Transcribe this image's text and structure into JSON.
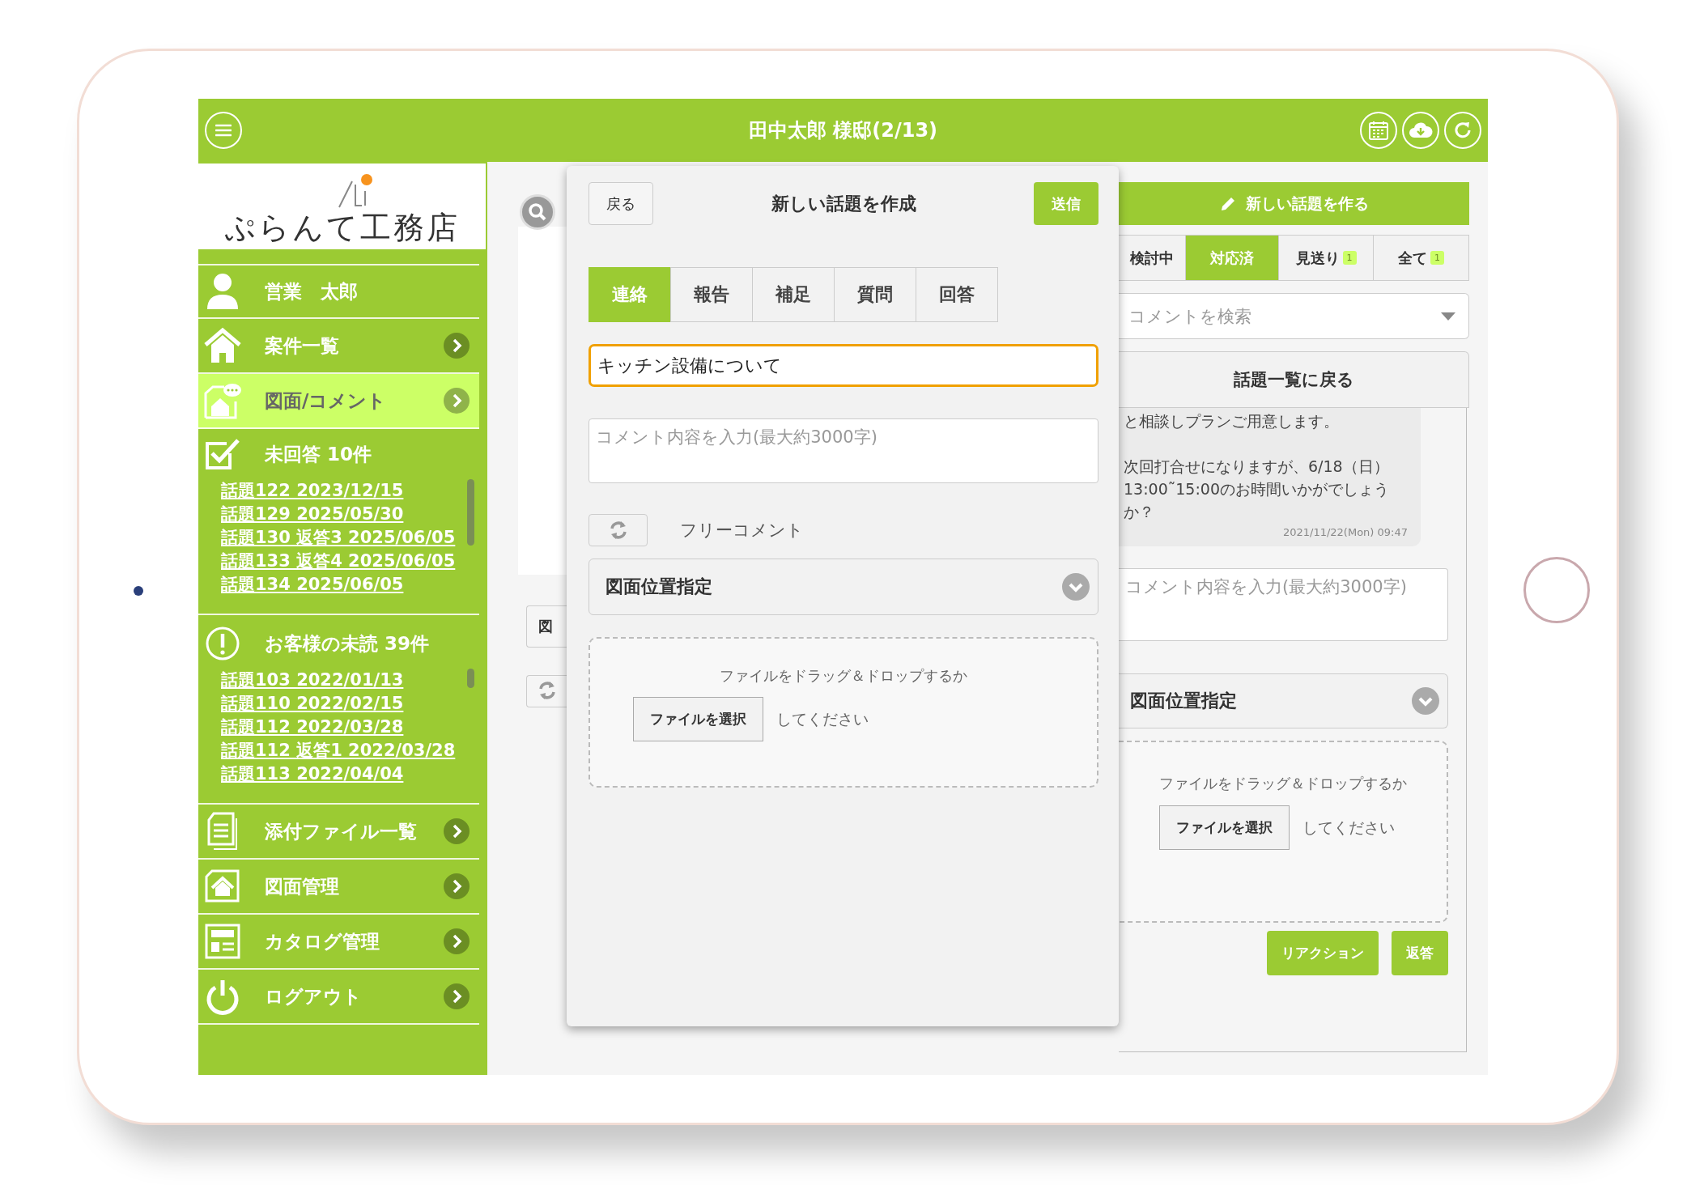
{
  "header": {
    "title": "田中太郎 様邸(2/13)"
  },
  "sidebar": {
    "logo": "ぷらんて工務店",
    "user": "営業　太郎",
    "nav": [
      {
        "label": "案件一覧",
        "selected": false
      },
      {
        "label": "図面/コメント",
        "selected": true
      }
    ],
    "sections": [
      {
        "title": "未回答 10件",
        "links": [
          "話題122 2023/12/15",
          "話題129 2025/05/30",
          "話題130 返答3 2025/06/05",
          "話題133 返答4 2025/06/05",
          "話題134 2025/06/05"
        ]
      },
      {
        "title": "お客様の未読 39件",
        "links": [
          "話題103 2022/01/13",
          "話題110 2022/02/15",
          "話題112 2022/03/28",
          "話題112 返答1 2022/03/28",
          "話題113 2022/04/04"
        ]
      }
    ],
    "nav_bottom": [
      {
        "label": "添付ファイル一覧",
        "selected": false
      },
      {
        "label": "図面管理",
        "selected": false
      },
      {
        "label": "カタログ管理",
        "selected": false
      },
      {
        "label": "ログアウト",
        "selected": false
      }
    ]
  },
  "background": {
    "button": "図"
  },
  "modal": {
    "back": "戻る",
    "title": "新しい話題を作成",
    "send": "送信",
    "tabs": [
      {
        "label": "連絡",
        "selected": true
      },
      {
        "label": "報告",
        "selected": false
      },
      {
        "label": "補足",
        "selected": false
      },
      {
        "label": "質問",
        "selected": false
      },
      {
        "label": "回答",
        "selected": false
      }
    ],
    "subject": {
      "value": "キッチン設備について"
    },
    "comment": {
      "placeholder": "コメント内容を入力(最大約3000字)"
    },
    "free_comment": "フリーコメント",
    "position_select": "図面位置指定",
    "dropzone": {
      "text": "ファイルをドラッグ＆ドロップするか",
      "button": "ファイルを選択",
      "suffix": "してください"
    }
  },
  "panel": {
    "new_topic": "新しい話題を作る",
    "tabs": [
      {
        "label": "検討中",
        "selected": false
      },
      {
        "label": "対応済",
        "selected": true
      },
      {
        "label": "見送り",
        "badge": "1",
        "selected": false
      },
      {
        "label": "全て",
        "badge": "1",
        "selected": false
      }
    ],
    "search": {
      "placeholder": "コメントを検索"
    },
    "back_to_list": "話題一覧に戻る",
    "message": {
      "paragraphs": [
        "と相談しプランご用意します。",
        "次回打合せになりますが、6/18（日）13:00˜15:00のお時間いかがでしょうか？"
      ],
      "time": "2021/11/22(Mon) 09:47"
    },
    "reply": {
      "placeholder": "コメント内容を入力(最大約3000字)"
    },
    "position_select": "図面位置指定",
    "dropzone": {
      "text": "ファイルをドラッグ＆ドロップするか",
      "button": "ファイルを選択",
      "suffix": "してください"
    },
    "buttons": [
      "リアクション",
      "返答"
    ]
  }
}
